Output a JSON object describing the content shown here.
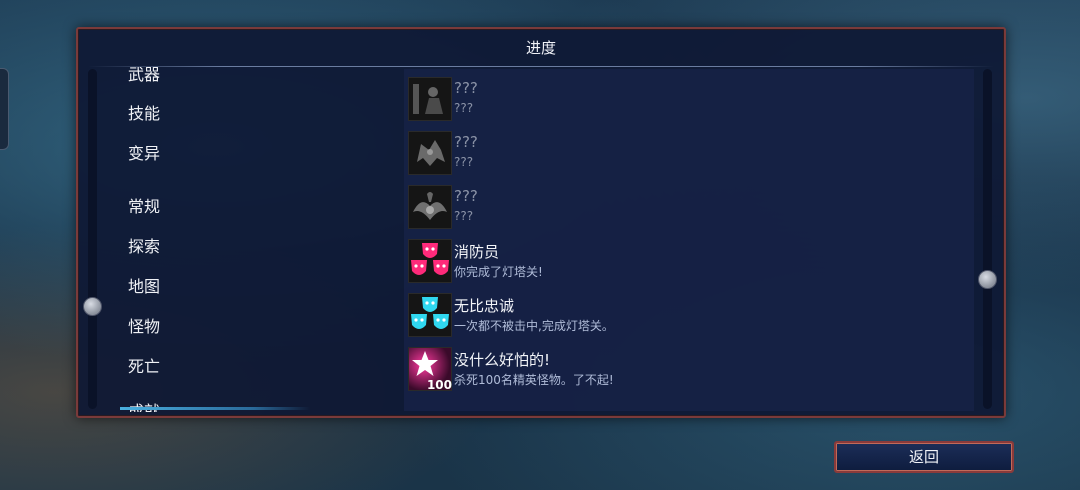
{
  "panel": {
    "title": "进度"
  },
  "categories": [
    "武器",
    "技能",
    "变异",
    "常规",
    "探索",
    "地图",
    "怪物",
    "死亡",
    "成就"
  ],
  "achievements": [
    {
      "name": "???",
      "desc": "???",
      "locked": true,
      "icon": "locked-figure-icon"
    },
    {
      "name": "???",
      "desc": "???",
      "locked": true,
      "icon": "locked-beast-icon"
    },
    {
      "name": "???",
      "desc": "???",
      "locked": true,
      "icon": "locked-bird-icon"
    },
    {
      "name": "消防员",
      "desc": "你完成了灯塔关!",
      "locked": false,
      "icon": "pink-masks-icon",
      "color": "#ff2a7a"
    },
    {
      "name": "无比忠诚",
      "desc": "一次都不被击中,完成灯塔关。",
      "locked": false,
      "icon": "cyan-masks-icon",
      "color": "#30d8f0"
    },
    {
      "name": "没什么好怕的!",
      "desc": "杀死100名精英怪物。了不起!",
      "locked": false,
      "icon": "star-100-icon",
      "color": "#ff3aa0",
      "badge": "100"
    }
  ],
  "back_button": {
    "label": "返回"
  }
}
